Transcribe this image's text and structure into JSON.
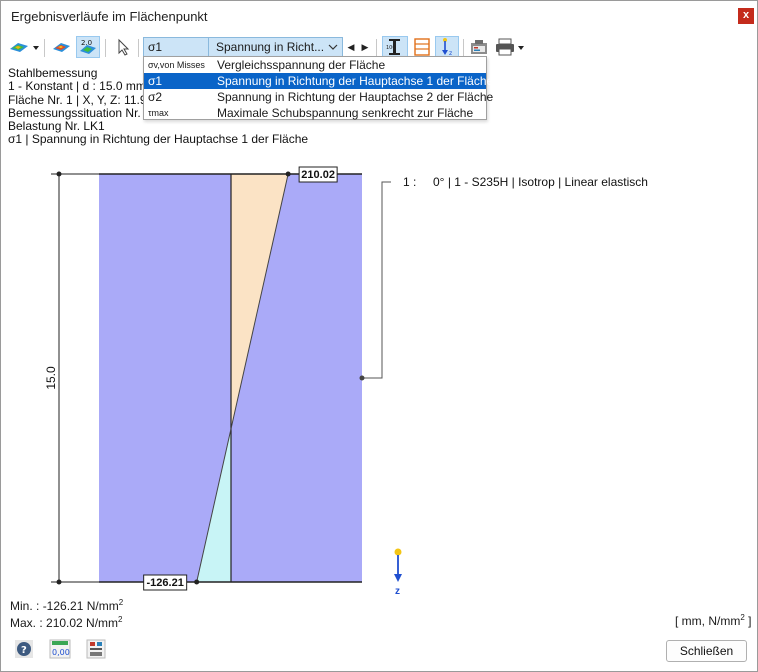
{
  "window": {
    "title": "Ergebnisverläufe im Flächenpunkt",
    "close_glyph": "x"
  },
  "toolbar": {
    "symbol_selected": "σ1",
    "result_selected": "Spannung in Richt...",
    "prev_glyph": "◀",
    "next_glyph": "▶",
    "icons": [
      "surface-result-dropdown-icon",
      "surface-results-icon",
      "result-values-icon",
      "select-pointer-icon",
      "thickness-dimension-icon",
      "layers-icon",
      "z-axis-arrow-icon",
      "camera-icon",
      "print-icon"
    ]
  },
  "info": {
    "lines": [
      "Stahlbemessung",
      "1 - Konstant | d : 15.0 mm |",
      "Fläche Nr. 1 | X, Y, Z: 11.947",
      "Bemessungssituation Nr. 1",
      "Belastung Nr. LK1",
      "σ1 | Spannung in Richtung der Hauptachse 1 der Fläche"
    ]
  },
  "dropdown": {
    "items": [
      {
        "symbol": "σv,von Misses",
        "label": "Vergleichsspannung der Fläche",
        "selected": false
      },
      {
        "symbol": "σ1",
        "label": "Spannung in Richtung der Hauptachse 1 der Fläche",
        "selected": true
      },
      {
        "symbol": "σ2",
        "label": "Spannung in Richtung der Hauptachse 2 der Fläche",
        "selected": false
      },
      {
        "symbol": "τmax",
        "label": "Maximale Schubspannung senkrecht zur Fläche",
        "selected": false
      }
    ]
  },
  "chart_data": {
    "type": "area",
    "title": "",
    "thickness_label": "15.0",
    "x": [
      -126.21,
      210.02
    ],
    "y": [
      15.0,
      0.0
    ],
    "max_label": "210.02",
    "min_label": "-126.21",
    "legend_entry": "1 :     0° | 1 - S235H | Isotrop | Linear elastisch",
    "axis_label": "z",
    "colors": {
      "layer_fill": "#aaaaf8",
      "positive_fill": "#fbe3c5",
      "negative_fill": "#c8f4f6",
      "z_arrow": "#1f4fd0",
      "z_dot": "#f3c514"
    }
  },
  "summary": {
    "min_label": "Min. :",
    "min_value": "-126.21 N/mm",
    "max_label": "Max. :",
    "max_value": "210.02 N/mm",
    "units": "[ mm, N/mm",
    "units_close": " ]",
    "exponent": "2"
  },
  "footer": {
    "close_label": "Schließen",
    "icons": [
      "help-icon",
      "decimal-places-icon",
      "settings-icon"
    ]
  }
}
